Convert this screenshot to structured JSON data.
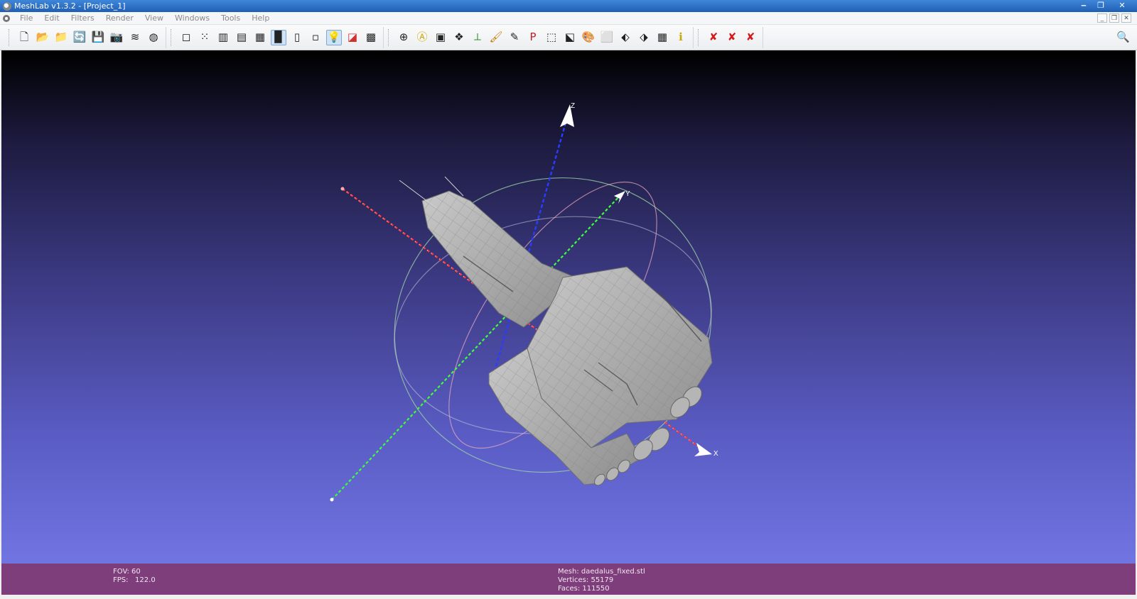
{
  "window": {
    "title": "MeshLab v1.3.2 - [Project_1]",
    "controls": {
      "minimize": "‒",
      "restore": "❐",
      "close": "✕"
    }
  },
  "menu": {
    "items": [
      "File",
      "Edit",
      "Filters",
      "Render",
      "View",
      "Windows",
      "Tools",
      "Help"
    ]
  },
  "toolbar": {
    "groups": [
      {
        "name": "file",
        "buttons": [
          {
            "icon": "new-project-icon",
            "glyph": "🗋"
          },
          {
            "icon": "open-project-icon",
            "glyph": "📂"
          },
          {
            "icon": "import-mesh-icon",
            "glyph": "📁"
          },
          {
            "icon": "reload-icon",
            "glyph": "🔄"
          },
          {
            "icon": "export-mesh-icon",
            "glyph": "💾"
          },
          {
            "icon": "snapshot-icon",
            "glyph": "📷"
          },
          {
            "icon": "layers-icon",
            "glyph": "≋"
          },
          {
            "icon": "view-icon",
            "glyph": "◍"
          }
        ]
      },
      {
        "name": "render",
        "buttons": [
          {
            "icon": "bbox-icon",
            "glyph": "◻"
          },
          {
            "icon": "points-icon",
            "glyph": "⁙"
          },
          {
            "icon": "wireframe-icon",
            "glyph": "▥"
          },
          {
            "icon": "hidden-lines-icon",
            "glyph": "▤"
          },
          {
            "icon": "flat-lines-icon",
            "glyph": "▦"
          },
          {
            "icon": "flat-icon",
            "glyph": "▉",
            "active": true
          },
          {
            "icon": "smooth-icon",
            "glyph": "▯"
          },
          {
            "icon": "texture-icon",
            "glyph": "▫"
          },
          {
            "icon": "light-icon",
            "glyph": "💡",
            "active": true
          },
          {
            "icon": "backface-icon",
            "glyph": "◪"
          },
          {
            "icon": "double-side-icon",
            "glyph": "▩"
          }
        ]
      },
      {
        "name": "edit",
        "buttons": [
          {
            "icon": "trackball-icon",
            "glyph": "⊕"
          },
          {
            "icon": "annotation-icon",
            "glyph": "Ⓐ"
          },
          {
            "icon": "texture-param-icon",
            "glyph": "▣"
          },
          {
            "icon": "align-icon",
            "glyph": "❖"
          },
          {
            "icon": "axis-icon",
            "glyph": "⟂"
          },
          {
            "icon": "paint-icon",
            "glyph": "🖌"
          },
          {
            "icon": "brush-icon",
            "glyph": "✎"
          },
          {
            "icon": "pickpoints-icon",
            "glyph": "P"
          },
          {
            "icon": "select-vertices-icon",
            "glyph": "⬚"
          },
          {
            "icon": "select-faces-icon",
            "glyph": "⬕"
          },
          {
            "icon": "color-icon",
            "glyph": "🎨"
          },
          {
            "icon": "select-area-icon",
            "glyph": "⬜"
          },
          {
            "icon": "select-connected-icon",
            "glyph": "⬖"
          },
          {
            "icon": "select-red-icon",
            "glyph": "⬗"
          },
          {
            "icon": "raster-icon",
            "glyph": "▦"
          },
          {
            "icon": "info-icon",
            "glyph": "ℹ"
          }
        ]
      },
      {
        "name": "delete",
        "buttons": [
          {
            "icon": "delete-faces-icon",
            "glyph": "✘"
          },
          {
            "icon": "delete-vertices-icon",
            "glyph": "✘"
          },
          {
            "icon": "delete-edges-icon",
            "glyph": "✘"
          }
        ]
      }
    ],
    "search_glyph": "🔍"
  },
  "viewport": {
    "axes": {
      "x_label": "X",
      "y_label": "Y",
      "z_label": "Z"
    }
  },
  "status": {
    "fov_label": "FOV:",
    "fov_value": "60",
    "fps_label": "FPS:",
    "fps_value": "122.0",
    "mesh_label": "Mesh:",
    "mesh_name": "daedalus_fixed.stl",
    "vertices_label": "Vertices:",
    "vertices_value": "55179",
    "faces_label": "Faces:",
    "faces_value": "111550"
  },
  "colors": {
    "status_bg": "#7e3e7c",
    "x_axis": "#ff3b3b",
    "y_axis": "#3cff3c",
    "z_axis": "#2a3cff"
  }
}
